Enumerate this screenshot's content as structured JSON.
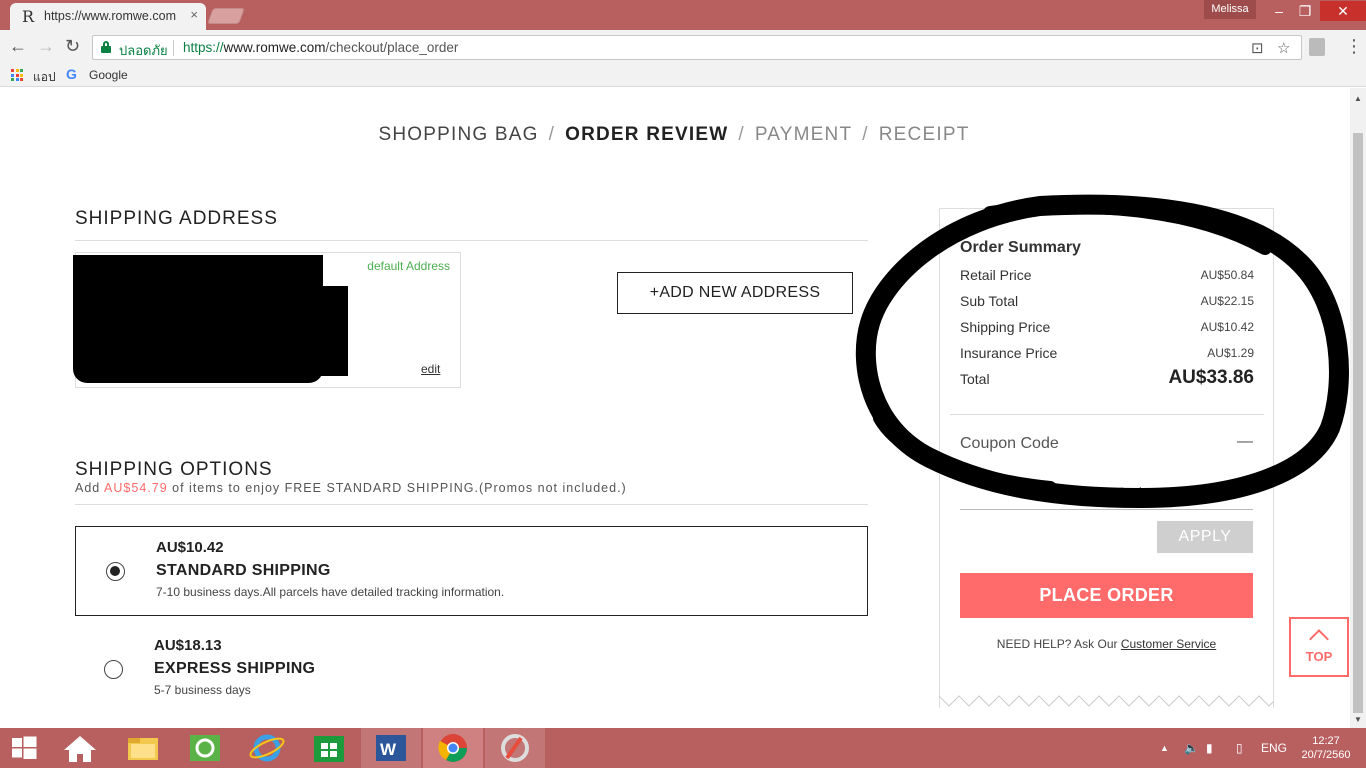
{
  "browser": {
    "tab_title": "https://www.romwe.com",
    "profile_name": "Melissa",
    "secure_label": "ปลอดภัย",
    "url_scheme": "https://",
    "url_host": "www.romwe.com",
    "url_path": "/checkout/place_order",
    "bookmarks": {
      "apps": "แอป",
      "google": "Google"
    }
  },
  "steps": {
    "shopping_bag": "SHOPPING BAG",
    "order_review": "ORDER REVIEW",
    "payment": "PAYMENT",
    "receipt": "RECEIPT",
    "separator": "/"
  },
  "shipping_address": {
    "title": "SHIPPING ADDRESS",
    "default_label": "default Address",
    "edit_label": "edit",
    "add_new_label": "+ADD NEW ADDRESS"
  },
  "shipping_options": {
    "title": "SHIPPING OPTIONS",
    "free_note_prefix": "Add",
    "free_note_amount": "AU$54.79",
    "free_note_suffix": "of items to enjoy FREE STANDARD SHIPPING.(Promos not included.)",
    "options": [
      {
        "price": "AU$10.42",
        "name": "STANDARD SHIPPING",
        "desc": "7-10 business days.All parcels have detailed tracking information.",
        "selected": true
      },
      {
        "price": "AU$18.13",
        "name": "EXPRESS SHIPPING",
        "desc": "5-7 business days",
        "selected": false
      }
    ]
  },
  "order_summary": {
    "title": "Order Summary",
    "rows": [
      {
        "label": "Retail Price",
        "value": "AU$50.84"
      },
      {
        "label": "Sub Total",
        "value": "AU$22.15"
      },
      {
        "label": "Shipping Price",
        "value": "AU$10.42"
      },
      {
        "label": "Insurance Price",
        "value": "AU$1.29"
      }
    ],
    "total_label": "Total",
    "total_value": "AU$33.86",
    "coupon_label": "Coupon Code",
    "coupon_toggle": "—",
    "coupon_placeholder": "Coupon Code",
    "apply_label": "APPLY",
    "place_order_label": "PLACE ORDER",
    "help_text": "NEED HELP? Ask Our",
    "help_link": "Customer Service"
  },
  "top_button": "TOP",
  "taskbar": {
    "language": "ENG",
    "time": "12:27",
    "date": "20/7/2560"
  },
  "colors": {
    "accent": "#ff6b6b",
    "chrome": "#b85f5f",
    "secure_green": "#0b8043",
    "default_green": "#4caf50"
  }
}
